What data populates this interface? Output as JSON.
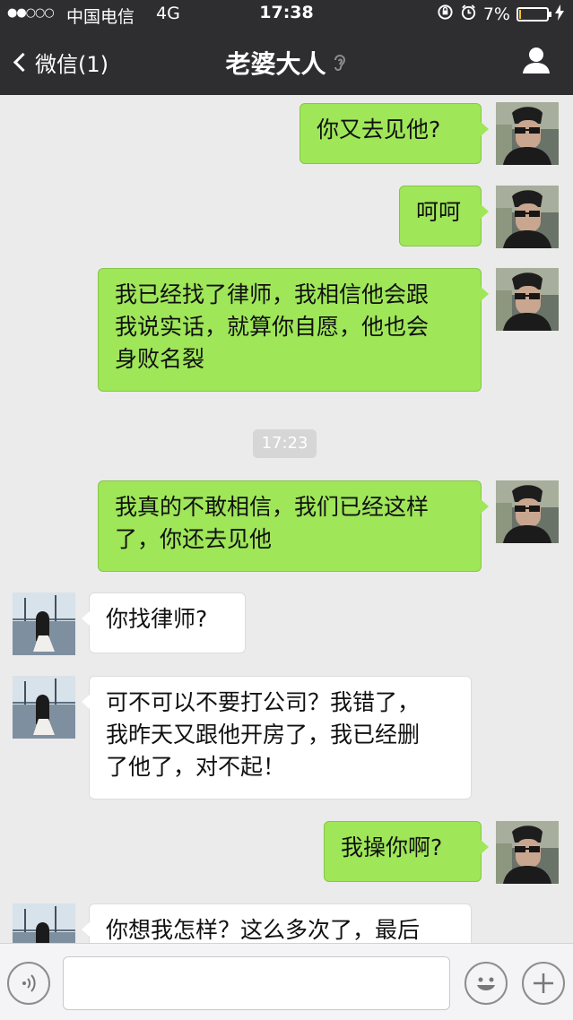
{
  "status_bar": {
    "signal": "●●○○○",
    "carrier": "中国电信",
    "network": "4G",
    "time": "17:38",
    "battery": "7%",
    "battery_level": 0.07,
    "battery_color": "#f2c230"
  },
  "nav": {
    "back_label": "微信(1)",
    "title": "老婆大人",
    "title_icon": "ear-icon",
    "right_icon": "profile-icon"
  },
  "messages": [
    {
      "side": "out",
      "text": "你又去见他?"
    },
    {
      "side": "out",
      "text": "呵呵"
    },
    {
      "side": "out",
      "lines": [
        "我已经找了律师，我相信他会跟",
        "我说实话，就算你自愿，他也会",
        "身败名裂"
      ]
    },
    {
      "type": "timestamp",
      "text": "17:23"
    },
    {
      "side": "out",
      "lines": [
        "我真的不敢相信，我们已经这样",
        "了，你还去见他"
      ]
    },
    {
      "side": "in",
      "text": "你找律师?"
    },
    {
      "side": "in",
      "lines": [
        "可不可以不要打公司？我错了，",
        "我昨天又跟他开房了，我已经删",
        "了他了，对不起！"
      ]
    },
    {
      "side": "out",
      "text": "我操你啊?"
    },
    {
      "side": "in",
      "text": "你想我怎样？这么多次了，最后"
    }
  ],
  "input_bar": {
    "voice_icon": "voice-icon",
    "text_value": "",
    "emoji_icon": "emoji-icon",
    "plus_icon": "plus-icon"
  },
  "colors": {
    "nav_background": "#2e2e30",
    "chat_background": "#ebebeb",
    "sent_bubble": "#9fe659",
    "received_bubble": "#ffffff"
  }
}
